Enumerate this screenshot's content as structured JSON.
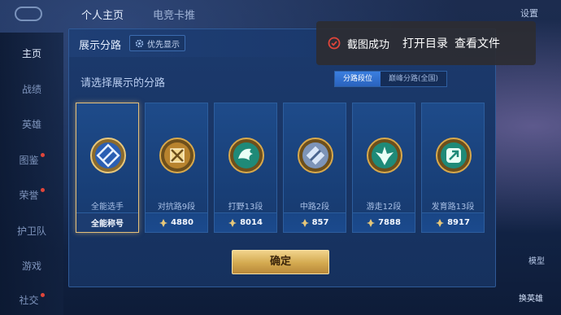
{
  "top_bar": {
    "tabs": [
      "个人主页",
      "电竞卡推"
    ],
    "right_label": "设置"
  },
  "sidebar": {
    "items": [
      "主页",
      "战绩",
      "英雄",
      "图鉴",
      "荣誉",
      "护卫队",
      "游戏",
      "社交"
    ]
  },
  "right_side": {
    "label_top": "模型",
    "label_bottom": "换英雄"
  },
  "modal": {
    "title": "展示分路",
    "priority_button": "优先显示",
    "prompt": "请选择展示的分路",
    "segments": [
      {
        "label": "分路段位",
        "active": true
      },
      {
        "label": "巅峰分路(全国)",
        "active": false
      }
    ],
    "cards": [
      {
        "label": "全能选手",
        "foot": "全能称号",
        "selected": true,
        "emblem": "all-round-emblem-icon"
      },
      {
        "label": "对抗路9段",
        "foot": "4880",
        "selected": false,
        "emblem": "clash-lane-emblem-icon"
      },
      {
        "label": "打野13段",
        "foot": "8014",
        "selected": false,
        "emblem": "jungle-emblem-icon"
      },
      {
        "label": "中路2段",
        "foot": "857",
        "selected": false,
        "emblem": "mid-lane-emblem-icon"
      },
      {
        "label": "游走12段",
        "foot": "7888",
        "selected": false,
        "emblem": "roam-emblem-icon"
      },
      {
        "label": "发育路13段",
        "foot": "8917",
        "selected": false,
        "emblem": "farm-lane-emblem-icon"
      }
    ],
    "confirm": "确定"
  },
  "toast": {
    "message": "截图成功",
    "open_folder": "打开目录",
    "view_file": "查看文件"
  },
  "colors": {
    "selected_border": "#e5c07a",
    "confirm_gold": "#d3a94f",
    "segment_active": "#3a7fe0",
    "toast_icon_red": "#e0453a"
  }
}
